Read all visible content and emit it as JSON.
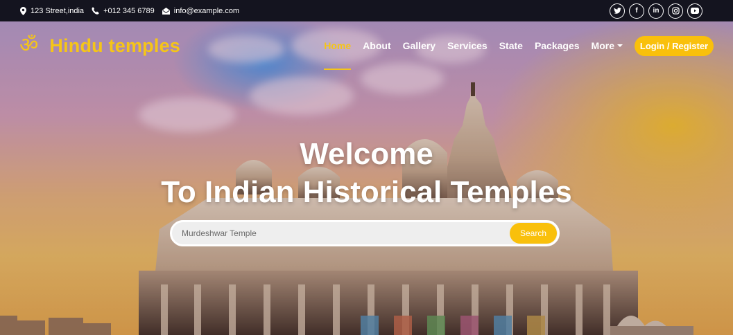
{
  "topbar": {
    "address": "123 Street,india",
    "phone": "+012 345 6789",
    "email": "info@example.com",
    "socials": [
      {
        "icon": "twitter-icon"
      },
      {
        "icon": "facebook-icon",
        "glyph": "f"
      },
      {
        "icon": "linkedin-icon",
        "glyph": "in"
      },
      {
        "icon": "instagram-icon"
      },
      {
        "icon": "youtube-icon"
      }
    ]
  },
  "brand": {
    "logo_glyph": "ॐ",
    "name": "Hindu temples",
    "color": "#f5c518"
  },
  "nav": {
    "items": [
      {
        "label": "Home",
        "active": true
      },
      {
        "label": "About"
      },
      {
        "label": "Gallery"
      },
      {
        "label": "Services"
      },
      {
        "label": "State"
      },
      {
        "label": "Packages"
      },
      {
        "label": "More"
      }
    ],
    "login_label": "Login / Register"
  },
  "hero": {
    "title_line1": "Welcome",
    "title_line2": "To Indian Historical Temples",
    "search_placeholder": "Murdeshwar Temple",
    "search_button": "Search"
  },
  "colors": {
    "accent": "#f9c00c",
    "topbar_bg": "#14141f"
  }
}
